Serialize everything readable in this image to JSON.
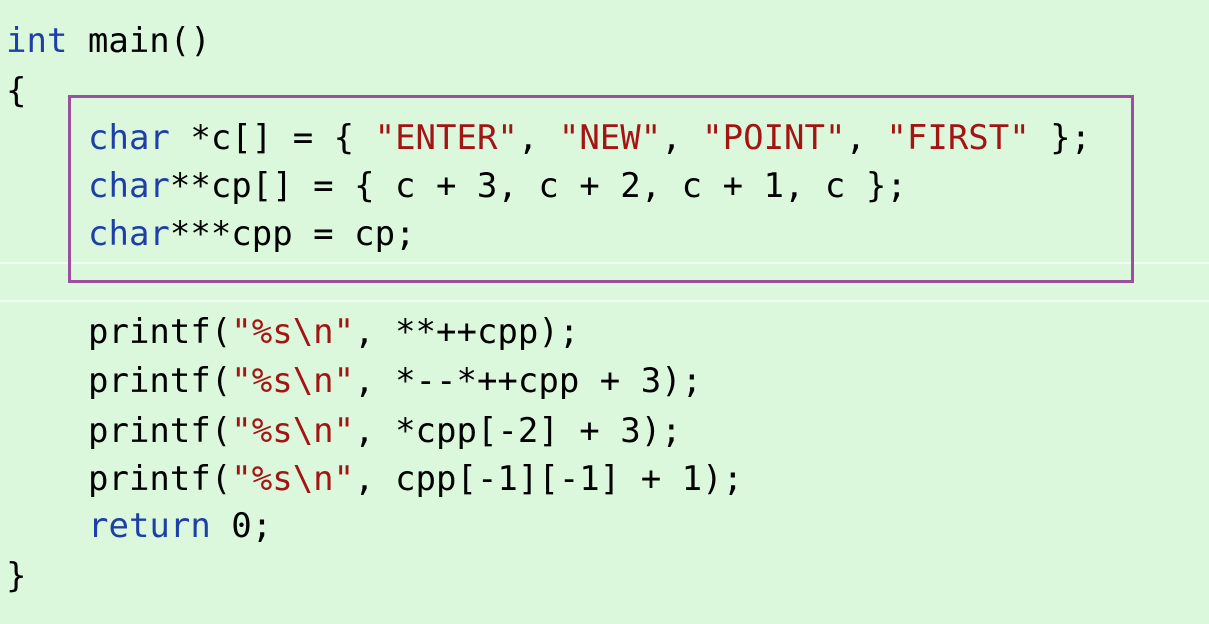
{
  "code": {
    "lines": [
      [
        {
          "t": "kw",
          "v": "int"
        },
        {
          "t": "pl",
          "v": " main()"
        }
      ],
      [
        {
          "t": "pl",
          "v": "{"
        }
      ],
      [
        {
          "t": "kw",
          "v": "char"
        },
        {
          "t": "pl",
          "v": " *c[] = { "
        },
        {
          "t": "str",
          "v": "\"ENTER\""
        },
        {
          "t": "pl",
          "v": ", "
        },
        {
          "t": "str",
          "v": "\"NEW\""
        },
        {
          "t": "pl",
          "v": ", "
        },
        {
          "t": "str",
          "v": "\"POINT\""
        },
        {
          "t": "pl",
          "v": ", "
        },
        {
          "t": "str",
          "v": "\"FIRST\""
        },
        {
          "t": "pl",
          "v": " };"
        }
      ],
      [
        {
          "t": "kw",
          "v": "char"
        },
        {
          "t": "pl",
          "v": "**cp[] = { c + 3, c + 2, c + 1, c };"
        }
      ],
      [
        {
          "t": "kw",
          "v": "char"
        },
        {
          "t": "pl",
          "v": "***cpp = cp;"
        }
      ],
      [
        {
          "t": "pl",
          "v": "printf("
        },
        {
          "t": "str",
          "v": "\"%s\\n\""
        },
        {
          "t": "pl",
          "v": ", **++cpp);"
        }
      ],
      [
        {
          "t": "pl",
          "v": "printf("
        },
        {
          "t": "str",
          "v": "\"%s\\n\""
        },
        {
          "t": "pl",
          "v": ", *--*++cpp + 3);"
        }
      ],
      [
        {
          "t": "pl",
          "v": "printf("
        },
        {
          "t": "str",
          "v": "\"%s\\n\""
        },
        {
          "t": "pl",
          "v": ", *cpp[-2] + 3);"
        }
      ],
      [
        {
          "t": "pl",
          "v": "printf("
        },
        {
          "t": "str",
          "v": "\"%s\\n\""
        },
        {
          "t": "pl",
          "v": ", cpp[-1][-1] + 1);"
        }
      ],
      [
        {
          "t": "kw",
          "v": "return"
        },
        {
          "t": "pl",
          "v": " 0;"
        }
      ],
      [
        {
          "t": "pl",
          "v": "}"
        }
      ]
    ]
  },
  "colors": {
    "background": "#dcf8dc",
    "keyword": "#1f3fa8",
    "string": "#a31515",
    "highlight_border": "#9c4f9e"
  }
}
